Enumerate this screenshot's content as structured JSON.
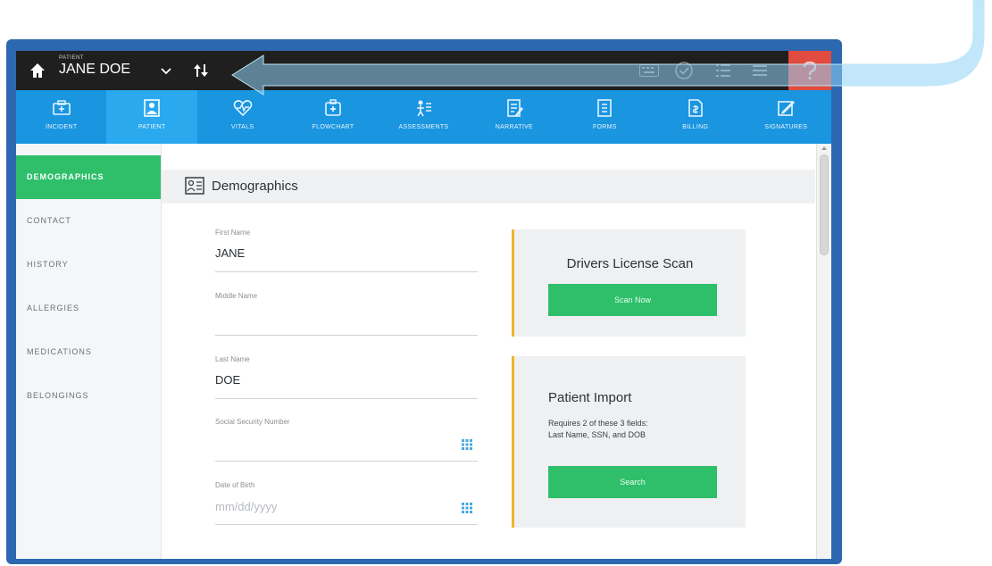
{
  "topbar": {
    "patient_label": "PATIENT",
    "patient_name": "JANE DOE"
  },
  "nav": {
    "items": [
      {
        "label": "INCIDENT",
        "icon": "incident-icon",
        "active": false
      },
      {
        "label": "PATIENT",
        "icon": "patient-icon",
        "active": true
      },
      {
        "label": "VITALS",
        "icon": "vitals-icon",
        "active": false
      },
      {
        "label": "FLOWCHART",
        "icon": "flowchart-icon",
        "active": false
      },
      {
        "label": "ASSESSMENTS",
        "icon": "assessments-icon",
        "active": false
      },
      {
        "label": "NARRATIVE",
        "icon": "narrative-icon",
        "active": false
      },
      {
        "label": "FORMS",
        "icon": "forms-icon",
        "active": false
      },
      {
        "label": "BILLING",
        "icon": "billing-icon",
        "active": false
      },
      {
        "label": "SIGNATURES",
        "icon": "signatures-icon",
        "active": false
      }
    ]
  },
  "sidebar": {
    "items": [
      {
        "label": "DEMOGRAPHICS",
        "active": true
      },
      {
        "label": "CONTACT",
        "active": false
      },
      {
        "label": "HISTORY",
        "active": false
      },
      {
        "label": "ALLERGIES",
        "active": false
      },
      {
        "label": "MEDICATIONS",
        "active": false
      },
      {
        "label": "BELONGINGS",
        "active": false
      }
    ]
  },
  "section": {
    "title": "Demographics"
  },
  "form": {
    "first_name": {
      "label": "First Name",
      "value": "JANE"
    },
    "middle_name": {
      "label": "Middle Name",
      "value": ""
    },
    "last_name": {
      "label": "Last Name",
      "value": "DOE"
    },
    "ssn": {
      "label": "Social Security Number",
      "value": ""
    },
    "dob": {
      "label": "Date of Birth",
      "placeholder": "mm/dd/yyyy"
    }
  },
  "license_card": {
    "title": "Drivers License Scan",
    "button": "Scan Now"
  },
  "import_card": {
    "title": "Patient Import",
    "desc_line1": "Requires 2 of these 3 fields:",
    "desc_line2": "Last Name, SSN, and DOB",
    "button": "Search"
  },
  "colors": {
    "frame": "#2d67b0",
    "topbar": "#1f1f1f",
    "nav": "#1a95e0",
    "nav_active": "#2aa9ef",
    "accent_green": "#2fbf6b",
    "card_border": "#f0b428",
    "help_red": "#e24b3f"
  }
}
